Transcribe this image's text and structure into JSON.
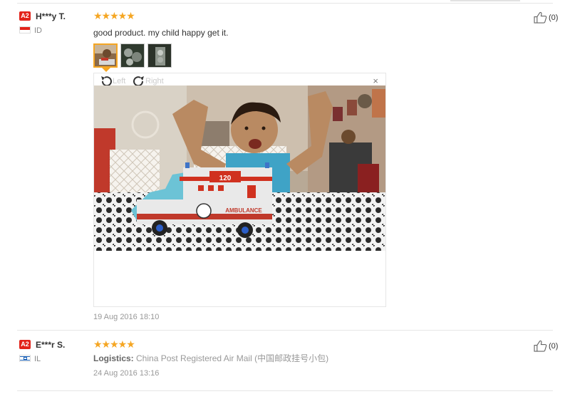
{
  "reviews": [
    {
      "badge": "A2",
      "user": "H***y T.",
      "country": "ID",
      "stars": "★★★★★",
      "text": "good product. my child happy get it.",
      "like_count": "(0)",
      "viewer": {
        "rotate_left": "Left",
        "rotate_right": "Right",
        "close": "×"
      },
      "date": "19 Aug 2016 18:10"
    },
    {
      "badge": "A2",
      "user": "E***r S.",
      "country": "IL",
      "stars": "★★★★★",
      "logistics_label": "Logistics:",
      "logistics_value": "China Post Registered Air Mail (中国邮政挂号小包)",
      "like_count": "(0)",
      "date": "24 Aug 2016 13:16"
    }
  ],
  "photo_overlay": {
    "truck_number": "120",
    "truck_label": "AMBULANCE"
  },
  "colors": {
    "star": "#f5a623",
    "badge": "#e2231a",
    "muted": "#999999"
  }
}
